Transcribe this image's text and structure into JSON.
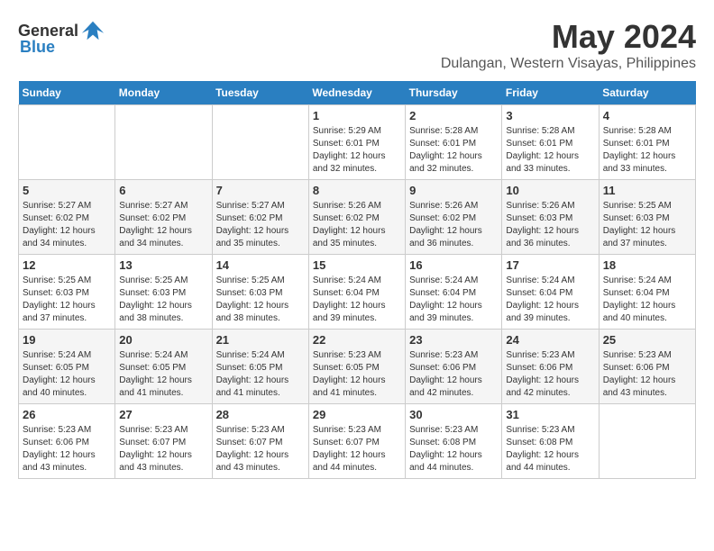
{
  "header": {
    "logo_general": "General",
    "logo_blue": "Blue",
    "month_title": "May 2024",
    "location": "Dulangan, Western Visayas, Philippines"
  },
  "days_of_week": [
    "Sunday",
    "Monday",
    "Tuesday",
    "Wednesday",
    "Thursday",
    "Friday",
    "Saturday"
  ],
  "weeks": [
    [
      {
        "day": "",
        "sunrise": "",
        "sunset": "",
        "daylight": ""
      },
      {
        "day": "",
        "sunrise": "",
        "sunset": "",
        "daylight": ""
      },
      {
        "day": "",
        "sunrise": "",
        "sunset": "",
        "daylight": ""
      },
      {
        "day": "1",
        "sunrise": "Sunrise: 5:29 AM",
        "sunset": "Sunset: 6:01 PM",
        "daylight": "Daylight: 12 hours and 32 minutes."
      },
      {
        "day": "2",
        "sunrise": "Sunrise: 5:28 AM",
        "sunset": "Sunset: 6:01 PM",
        "daylight": "Daylight: 12 hours and 32 minutes."
      },
      {
        "day": "3",
        "sunrise": "Sunrise: 5:28 AM",
        "sunset": "Sunset: 6:01 PM",
        "daylight": "Daylight: 12 hours and 33 minutes."
      },
      {
        "day": "4",
        "sunrise": "Sunrise: 5:28 AM",
        "sunset": "Sunset: 6:01 PM",
        "daylight": "Daylight: 12 hours and 33 minutes."
      }
    ],
    [
      {
        "day": "5",
        "sunrise": "Sunrise: 5:27 AM",
        "sunset": "Sunset: 6:02 PM",
        "daylight": "Daylight: 12 hours and 34 minutes."
      },
      {
        "day": "6",
        "sunrise": "Sunrise: 5:27 AM",
        "sunset": "Sunset: 6:02 PM",
        "daylight": "Daylight: 12 hours and 34 minutes."
      },
      {
        "day": "7",
        "sunrise": "Sunrise: 5:27 AM",
        "sunset": "Sunset: 6:02 PM",
        "daylight": "Daylight: 12 hours and 35 minutes."
      },
      {
        "day": "8",
        "sunrise": "Sunrise: 5:26 AM",
        "sunset": "Sunset: 6:02 PM",
        "daylight": "Daylight: 12 hours and 35 minutes."
      },
      {
        "day": "9",
        "sunrise": "Sunrise: 5:26 AM",
        "sunset": "Sunset: 6:02 PM",
        "daylight": "Daylight: 12 hours and 36 minutes."
      },
      {
        "day": "10",
        "sunrise": "Sunrise: 5:26 AM",
        "sunset": "Sunset: 6:03 PM",
        "daylight": "Daylight: 12 hours and 36 minutes."
      },
      {
        "day": "11",
        "sunrise": "Sunrise: 5:25 AM",
        "sunset": "Sunset: 6:03 PM",
        "daylight": "Daylight: 12 hours and 37 minutes."
      }
    ],
    [
      {
        "day": "12",
        "sunrise": "Sunrise: 5:25 AM",
        "sunset": "Sunset: 6:03 PM",
        "daylight": "Daylight: 12 hours and 37 minutes."
      },
      {
        "day": "13",
        "sunrise": "Sunrise: 5:25 AM",
        "sunset": "Sunset: 6:03 PM",
        "daylight": "Daylight: 12 hours and 38 minutes."
      },
      {
        "day": "14",
        "sunrise": "Sunrise: 5:25 AM",
        "sunset": "Sunset: 6:03 PM",
        "daylight": "Daylight: 12 hours and 38 minutes."
      },
      {
        "day": "15",
        "sunrise": "Sunrise: 5:24 AM",
        "sunset": "Sunset: 6:04 PM",
        "daylight": "Daylight: 12 hours and 39 minutes."
      },
      {
        "day": "16",
        "sunrise": "Sunrise: 5:24 AM",
        "sunset": "Sunset: 6:04 PM",
        "daylight": "Daylight: 12 hours and 39 minutes."
      },
      {
        "day": "17",
        "sunrise": "Sunrise: 5:24 AM",
        "sunset": "Sunset: 6:04 PM",
        "daylight": "Daylight: 12 hours and 39 minutes."
      },
      {
        "day": "18",
        "sunrise": "Sunrise: 5:24 AM",
        "sunset": "Sunset: 6:04 PM",
        "daylight": "Daylight: 12 hours and 40 minutes."
      }
    ],
    [
      {
        "day": "19",
        "sunrise": "Sunrise: 5:24 AM",
        "sunset": "Sunset: 6:05 PM",
        "daylight": "Daylight: 12 hours and 40 minutes."
      },
      {
        "day": "20",
        "sunrise": "Sunrise: 5:24 AM",
        "sunset": "Sunset: 6:05 PM",
        "daylight": "Daylight: 12 hours and 41 minutes."
      },
      {
        "day": "21",
        "sunrise": "Sunrise: 5:24 AM",
        "sunset": "Sunset: 6:05 PM",
        "daylight": "Daylight: 12 hours and 41 minutes."
      },
      {
        "day": "22",
        "sunrise": "Sunrise: 5:23 AM",
        "sunset": "Sunset: 6:05 PM",
        "daylight": "Daylight: 12 hours and 41 minutes."
      },
      {
        "day": "23",
        "sunrise": "Sunrise: 5:23 AM",
        "sunset": "Sunset: 6:06 PM",
        "daylight": "Daylight: 12 hours and 42 minutes."
      },
      {
        "day": "24",
        "sunrise": "Sunrise: 5:23 AM",
        "sunset": "Sunset: 6:06 PM",
        "daylight": "Daylight: 12 hours and 42 minutes."
      },
      {
        "day": "25",
        "sunrise": "Sunrise: 5:23 AM",
        "sunset": "Sunset: 6:06 PM",
        "daylight": "Daylight: 12 hours and 43 minutes."
      }
    ],
    [
      {
        "day": "26",
        "sunrise": "Sunrise: 5:23 AM",
        "sunset": "Sunset: 6:06 PM",
        "daylight": "Daylight: 12 hours and 43 minutes."
      },
      {
        "day": "27",
        "sunrise": "Sunrise: 5:23 AM",
        "sunset": "Sunset: 6:07 PM",
        "daylight": "Daylight: 12 hours and 43 minutes."
      },
      {
        "day": "28",
        "sunrise": "Sunrise: 5:23 AM",
        "sunset": "Sunset: 6:07 PM",
        "daylight": "Daylight: 12 hours and 43 minutes."
      },
      {
        "day": "29",
        "sunrise": "Sunrise: 5:23 AM",
        "sunset": "Sunset: 6:07 PM",
        "daylight": "Daylight: 12 hours and 44 minutes."
      },
      {
        "day": "30",
        "sunrise": "Sunrise: 5:23 AM",
        "sunset": "Sunset: 6:08 PM",
        "daylight": "Daylight: 12 hours and 44 minutes."
      },
      {
        "day": "31",
        "sunrise": "Sunrise: 5:23 AM",
        "sunset": "Sunset: 6:08 PM",
        "daylight": "Daylight: 12 hours and 44 minutes."
      },
      {
        "day": "",
        "sunrise": "",
        "sunset": "",
        "daylight": ""
      }
    ]
  ]
}
